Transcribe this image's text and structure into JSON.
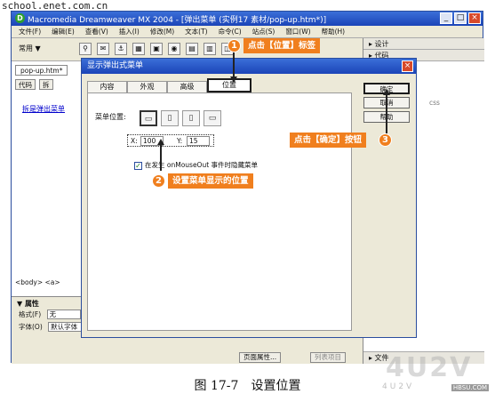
{
  "watermark_top": "school.enet.com.cn",
  "window": {
    "title": "Macromedia Dreamweaver MX 2004 - [弹出菜单 (实例17 素材/pop-up.htm*)]",
    "app_icon": "D",
    "btn_min": "_",
    "btn_max": "□",
    "btn_close": "×"
  },
  "menubar": [
    "文件(F)",
    "编辑(E)",
    "查看(V)",
    "插入(I)",
    "修改(M)",
    "文本(T)",
    "命令(C)",
    "站点(S)",
    "窗口(W)",
    "帮助(H)"
  ],
  "toolbar": {
    "category": "常用 ▼"
  },
  "right_panel": {
    "design": "▸ 设计",
    "code": "▸ 代码",
    "css": "css",
    "files": "▸ 文件"
  },
  "document": {
    "tab": "pop-up.htm*",
    "view_code": "代码",
    "view_split": "拆",
    "link_text": "拆是弹出菜单",
    "tag_selector": "<body> <a>"
  },
  "properties": {
    "header": "▼ 属性",
    "format_label": "格式(F)",
    "format_value": "无",
    "font_label": "字体(O)",
    "font_value": "默认字体",
    "page_props": "页面属性...",
    "list_item": "列表项目"
  },
  "dialog": {
    "title": "显示弹出式菜单",
    "close": "×",
    "tabs": [
      "内容",
      "外观",
      "高级",
      "位置"
    ],
    "active_tab": 3,
    "menu_position_label": "菜单位置:",
    "x_label": "X:",
    "x_value": "100",
    "y_label": "Y:",
    "y_value": "15",
    "checkbox_label": "在发生 onMouseOut 事件时隐藏菜单",
    "checkbox_mark": "✓",
    "ok": "确定",
    "cancel": "取消",
    "help": "帮助"
  },
  "annotations": {
    "step1_num": "1",
    "step1_text": "点击【位置】标签",
    "step2_num": "2",
    "step2_text": "设置菜单显示的位置",
    "step3_num": "3",
    "step3_text": "点击【确定】按钮",
    "accent_color": "#f07f1e"
  },
  "caption": "图 17-7　设置位置",
  "logo_watermark": {
    "big": "4U2V",
    "small": "4U2V",
    "domain": "HBSU.COM"
  }
}
